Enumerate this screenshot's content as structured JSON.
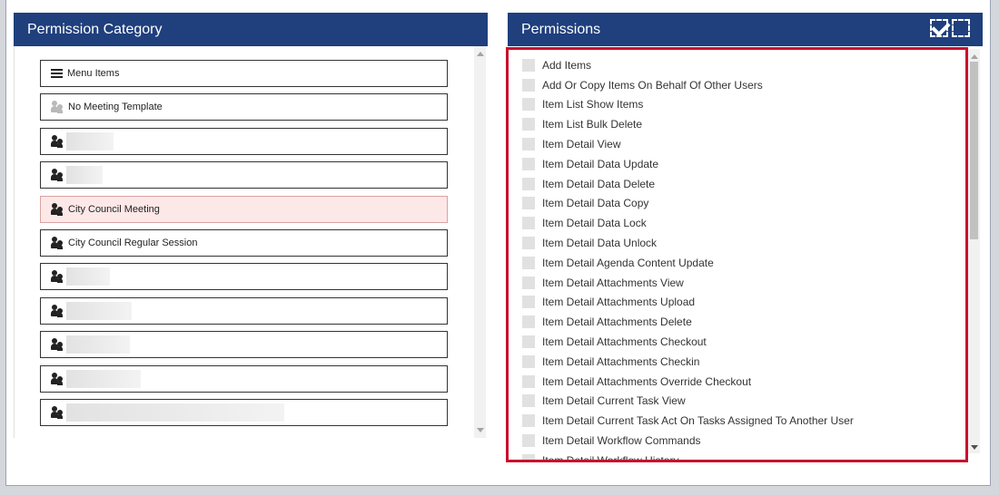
{
  "category_panel": {
    "title": "Permission Category",
    "items": [
      {
        "label": "Menu Items",
        "icon": "menu-icon",
        "selected": false
      },
      {
        "label": "No Meeting Template",
        "icon": "people-icon-light",
        "selected": false
      },
      {
        "label": "",
        "icon": "people-icon",
        "selected": false,
        "redacted": true
      },
      {
        "label": "",
        "icon": "people-icon",
        "selected": false,
        "redacted": true
      },
      {
        "label": "City Council Meeting",
        "icon": "people-icon",
        "selected": true
      },
      {
        "label": "City Council Regular Session",
        "icon": "people-icon",
        "selected": false
      },
      {
        "label": "",
        "icon": "people-icon",
        "selected": false,
        "redacted": true
      },
      {
        "label": "",
        "icon": "people-icon",
        "selected": false,
        "redacted": true
      },
      {
        "label": "",
        "icon": "people-icon",
        "selected": false,
        "redacted": true
      },
      {
        "label": "",
        "icon": "people-icon",
        "selected": false,
        "redacted": true
      },
      {
        "label": "",
        "icon": "people-icon",
        "selected": false,
        "redacted": true
      }
    ]
  },
  "permissions_panel": {
    "title": "Permissions",
    "select_all_icon": "check-all-icon",
    "deselect_all_icon": "uncheck-all-icon",
    "items": [
      "Add Items",
      "Add Or Copy Items On Behalf Of Other Users",
      "Item List Show Items",
      "Item List Bulk Delete",
      "Item Detail View",
      "Item Detail Data Update",
      "Item Detail Data Delete",
      "Item Detail Data Copy",
      "Item Detail Data Lock",
      "Item Detail Data Unlock",
      "Item Detail Agenda Content Update",
      "Item Detail Attachments View",
      "Item Detail Attachments Upload",
      "Item Detail Attachments Delete",
      "Item Detail Attachments Checkout",
      "Item Detail Attachments Checkin",
      "Item Detail Attachments Override Checkout",
      "Item Detail Current Task View",
      "Item Detail Current Task Act On Tasks Assigned To Another User",
      "Item Detail Workflow Commands",
      "Item Detail Workflow History"
    ]
  },
  "colors": {
    "header_bg": "#1f3f7d",
    "selected_bg": "#fde8e8",
    "highlight_border": "#c8102e"
  }
}
